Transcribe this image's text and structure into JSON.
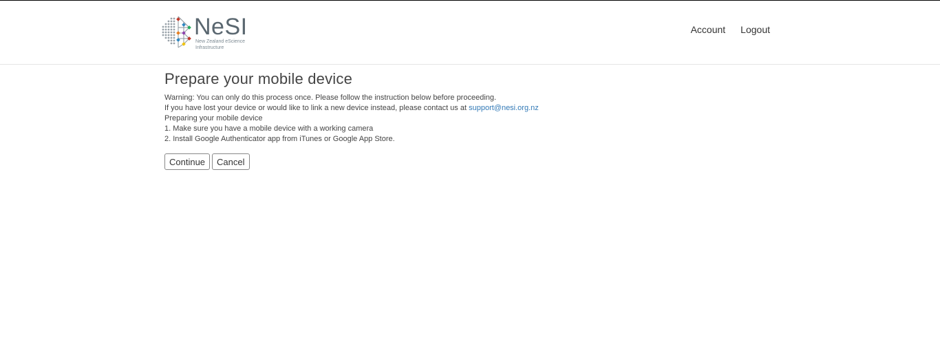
{
  "header": {
    "logo_name": "NeSI",
    "logo_subtitle": "New Zealand eScience Infrastructure",
    "nav": {
      "account_label": "Account",
      "logout_label": "Logout"
    }
  },
  "main": {
    "title": "Prepare your mobile device",
    "warning": "Warning: You can only do this process once. Please follow the instruction below before proceeding.",
    "lost_device_text": "If you have lost your device or would like to link a new device instead, please contact us at",
    "support_email": "support@nesi.org.nz",
    "preparing_heading": "Preparing your mobile device",
    "step1": "1. Make sure you have a mobile device with a working camera",
    "step2": "2. Install Google Authenticator app from iTunes or Google App Store.",
    "buttons": {
      "continue_label": "Continue",
      "cancel_label": "Cancel"
    }
  },
  "colors": {
    "link": "#337ab7",
    "logo_text": "#5a6770"
  }
}
